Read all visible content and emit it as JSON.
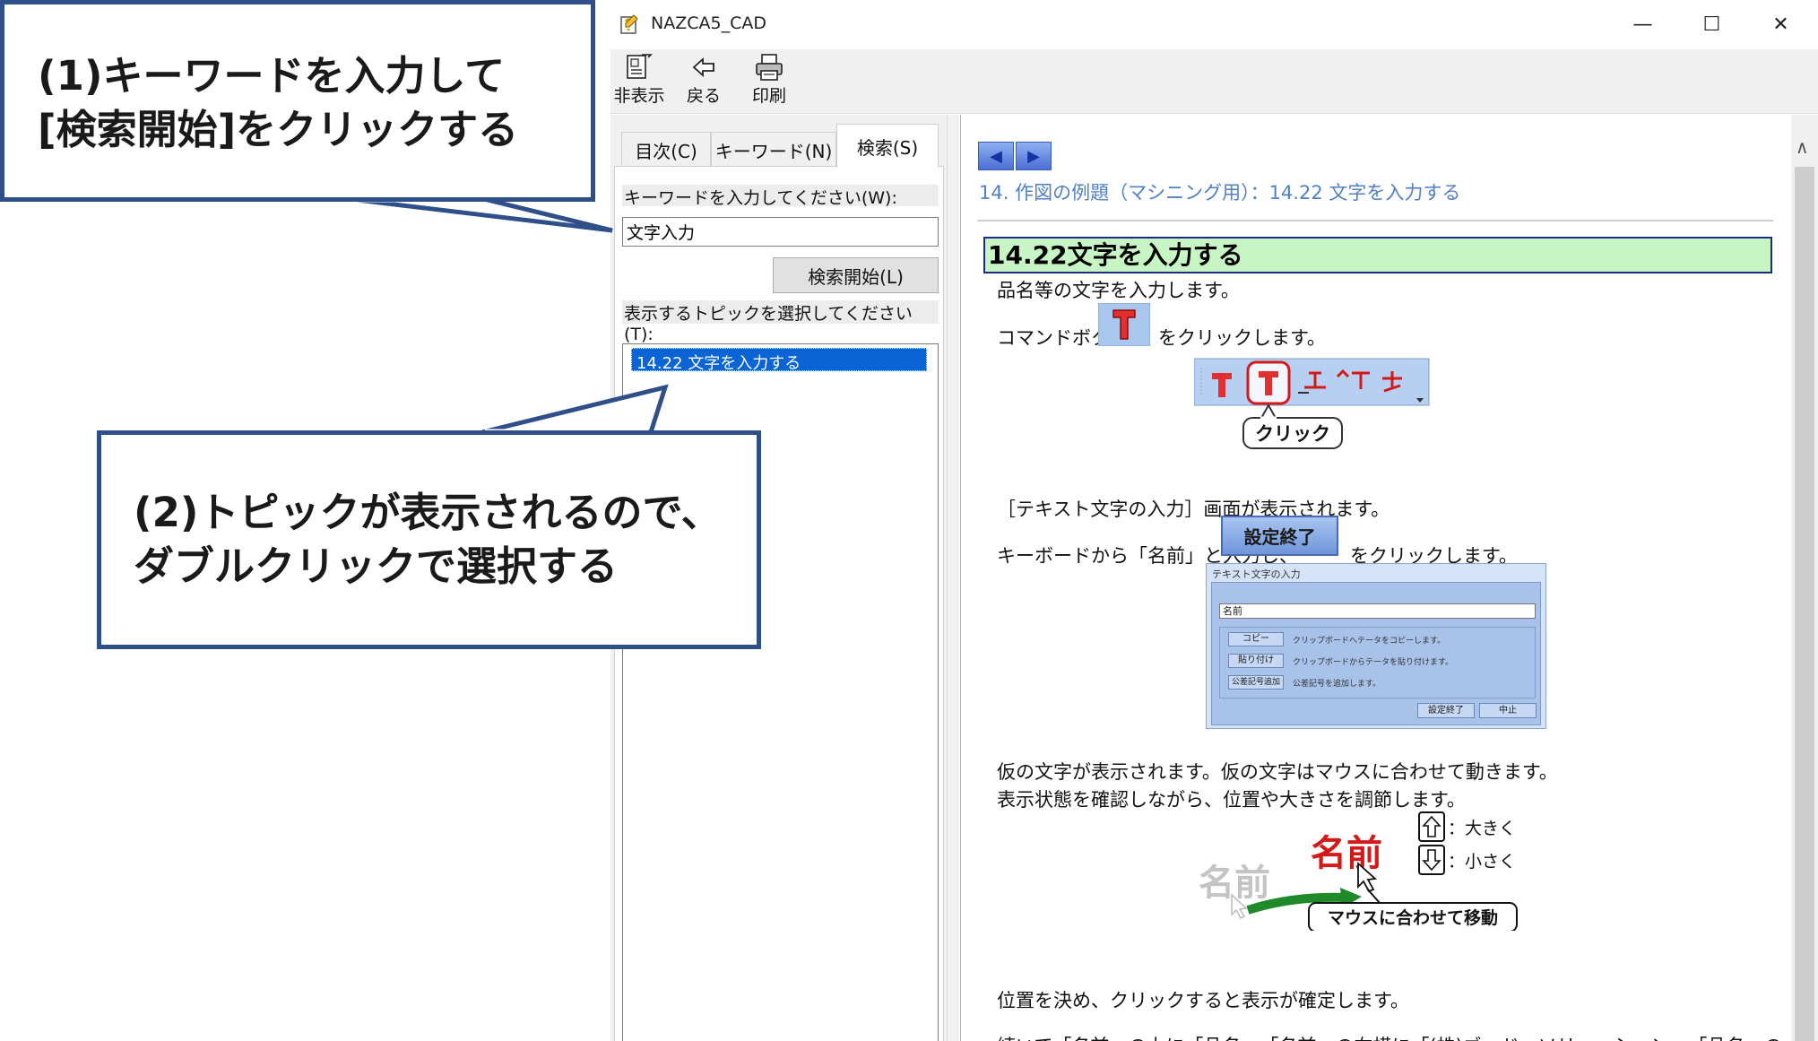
{
  "window": {
    "title": "NAZCA5_CAD"
  },
  "toolbar": {
    "hide_label": "非表示",
    "back_label": "戻る",
    "print_label": "印刷"
  },
  "nav": {
    "tabs": [
      "目次(C)",
      "キーワード(N)",
      "検索(S)"
    ],
    "keyword_label": "キーワードを入力してください(W):",
    "keyword_value": "文字入力",
    "search_button": "検索開始(L)",
    "topic_label": "表示するトピックを選択してください(T):",
    "topics": [
      "14.22 文字を入力する"
    ]
  },
  "content": {
    "breadcrumb": "14. 作図の例題（マシニング用）：14.22 文字を入力する",
    "heading": "14.22文字を入力する",
    "lines": [
      "品名等の文字を入力します。",
      "コマンドボタン",
      "をクリックします。",
      "［テキスト文字の入力］画面が表示されます。",
      "キーボードから「名前」と入力し、",
      "をクリックします。",
      "仮の文字が表示されます。仮の文字はマウスに合わせて動きます。",
      "表示状態を確認しながら、位置や大きさを調節します。",
      "位置を決め、クリックすると表示が確定します。",
      "続いて「名前」の上に「品名」、「名前」の右横に「(株)ゴードーソリューション」、「品名」の"
    ],
    "figure1": {
      "click_label": "クリック"
    },
    "setting_button": "設定終了",
    "dialog": {
      "title": "テキスト文字の入力",
      "field_value": "名前",
      "rows": [
        {
          "button": "コピー",
          "text": "クリップボードへテータをコピーします。"
        },
        {
          "button": "貼り付け",
          "text": "クリップボードからテータを貼り付けます。"
        },
        {
          "button": "公差記号追加",
          "text": "公差記号を追加します。"
        }
      ],
      "ok": "設定終了",
      "cancel": "中止"
    },
    "figure3": {
      "ghost_text": "名前",
      "live_text": "名前",
      "up_label": "：大きく",
      "down_label": "：小さく",
      "move_label": "マウスに合わせて移動"
    }
  },
  "callouts": {
    "step1_line1": "(1)キーワードを入力して",
    "step1_line2": "[検索開始]をクリックする",
    "step2_line1": "(2)トピックが表示されるので、",
    "step2_line2": "ダブルクリックで選択する"
  },
  "colors": {
    "callout_border": "#2e4f8a",
    "selection": "#0a64d6",
    "heading_bg": "#c8f5c4",
    "breadcrumb": "#4f80c8",
    "accent_red": "#d21a1a"
  }
}
